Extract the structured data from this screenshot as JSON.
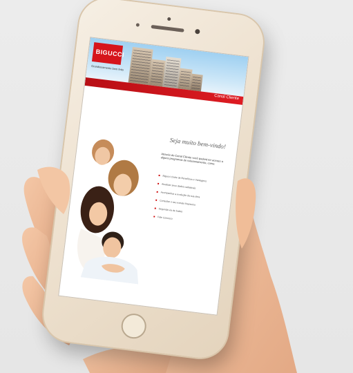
{
  "brand": {
    "logo_text": "BIGUCCI",
    "tagline": "Grandiosamente bem feito",
    "header_link": "Canal Cliente"
  },
  "content": {
    "welcome": "Seja muito bem-vindo!",
    "intro": "Através do Canal Cliente você poderá ter acesso a alguns programas de relacionamento, como:",
    "features": [
      "Bigucci Clube de Benefícios e Vantagens",
      "Atualizar seus dados cadastrais",
      "Acompanhar a evolução da sua obra",
      "Consultar o seu extrato financeiro",
      "Segunda via de boleto",
      "Fale Conosco"
    ]
  },
  "colors": {
    "brand_red": "#d6151c",
    "sky_blue": "#9fd0f1",
    "phone_gold": "#efe3d2"
  }
}
